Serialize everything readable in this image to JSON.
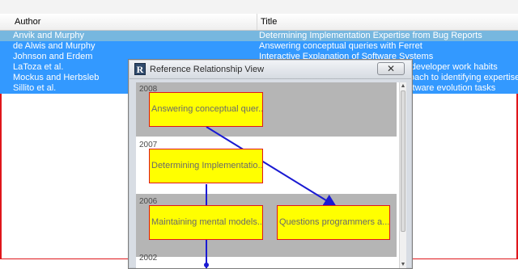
{
  "table": {
    "columns": {
      "author": "Author",
      "title": "Title"
    },
    "rows": [
      {
        "author": "Anvik and Murphy",
        "title": "Determining Implementation Expertise from Bug Reports"
      },
      {
        "author": "de Alwis and Murphy",
        "title": "Answering conceptual queries with Ferret"
      },
      {
        "author": "Johnson and Erdem",
        "title": "Interactive Explanation of Software Systems"
      },
      {
        "author": "LaToza et al.",
        "title": "Maintaining mental models: a study of developer work habits"
      },
      {
        "author": "Mockus and Herbsleb",
        "title": "Expertise Browser: a quantitative approach to identifying expertise"
      },
      {
        "author": "Sillito et al.",
        "title": "Questions programmers ask during software evolution tasks"
      }
    ]
  },
  "window": {
    "title": "Reference Relationship View",
    "icon_letter": "R",
    "close_label": "✕",
    "years": [
      "2008",
      "2007",
      "2006",
      "2002"
    ],
    "nodes": [
      {
        "label": "Answering conceptual quer..."
      },
      {
        "label": "Determining Implementatio..."
      },
      {
        "label": "Maintaining mental models..."
      },
      {
        "label": "Questions programmers a..."
      }
    ],
    "edge_color": "#1a1ad2",
    "node_color": "#ffff00",
    "node_border_color": "#e0161b"
  },
  "colors": {
    "selection": "#3399ff",
    "first_row_selection": "#77b7df",
    "frame_border": "#e0161b"
  }
}
